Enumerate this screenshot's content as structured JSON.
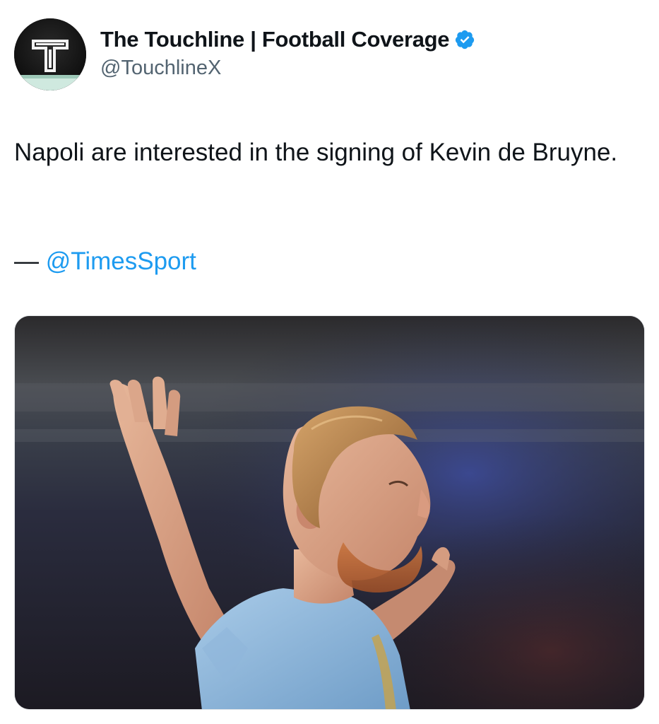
{
  "author": {
    "display_name": "The Touchline | Football Coverage",
    "handle": "@TouchlineX",
    "avatar_letter": "T",
    "verified": true,
    "verified_color": "#1d9bf0",
    "avatar_icon": "touchline-logo-icon"
  },
  "tweet": {
    "text": "Napoli are interested in the signing of Kevin de Bruyne.",
    "source_prefix": "— ",
    "source_mention": "@TimesSport"
  },
  "media": {
    "type": "photo",
    "icon": "photo-player-celebrating"
  },
  "colors": {
    "text": "#0f1419",
    "secondary": "#536471",
    "link": "#1d9bf0"
  }
}
